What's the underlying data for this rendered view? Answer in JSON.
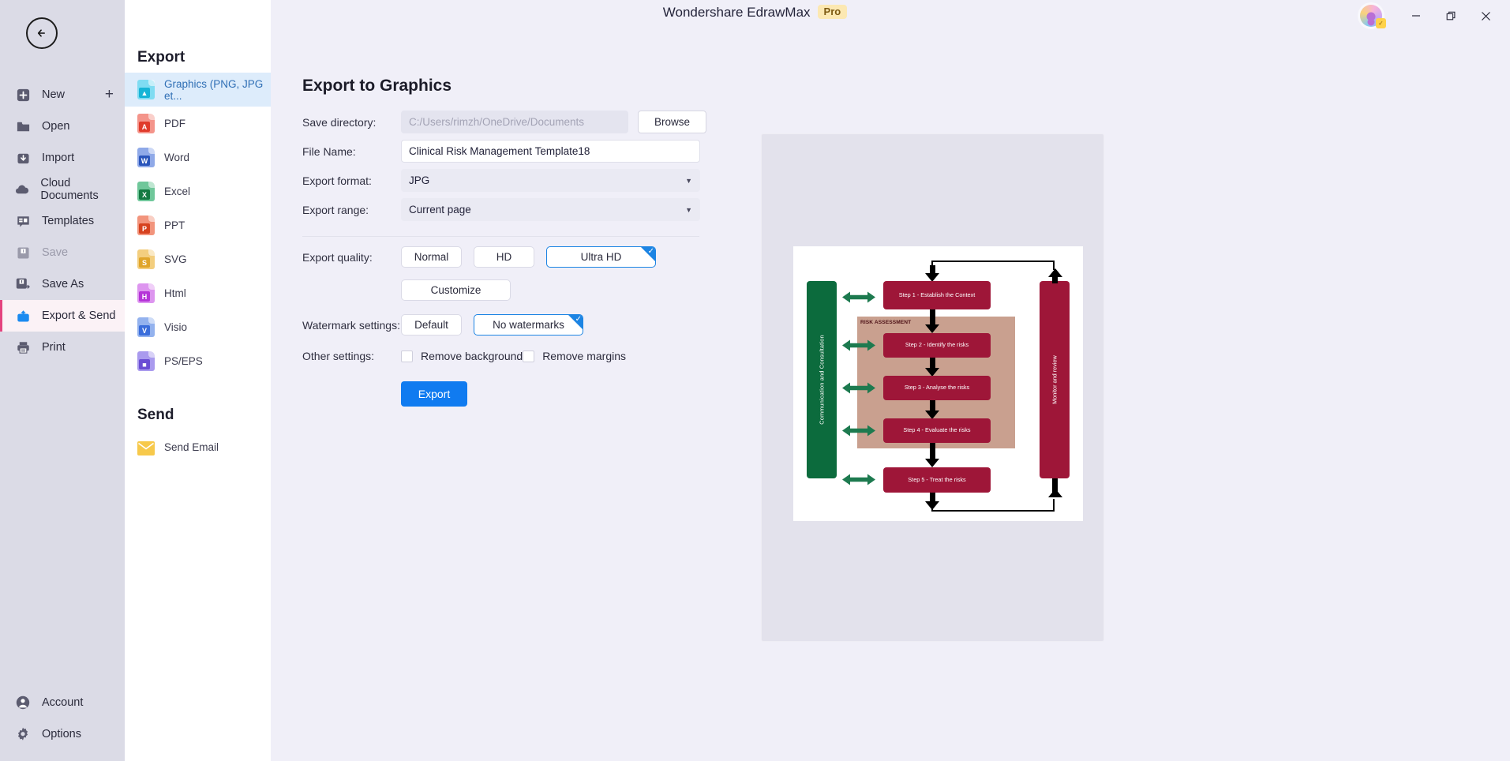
{
  "window": {
    "app_title": "Wondershare EdrawMax",
    "pro_badge": "Pro",
    "minimize": "—",
    "restore": "❐",
    "close": "✕"
  },
  "toolbar_icons": [
    {
      "name": "help-icon",
      "glyph": "?",
      "badge": true,
      "caret": true
    },
    {
      "name": "notifications-icon",
      "glyph": "🔔",
      "badge": true,
      "caret": false
    },
    {
      "name": "apps-grid-icon",
      "glyph": "☷",
      "badge": false,
      "caret": true
    },
    {
      "name": "theme-shirt-icon",
      "glyph": "👕",
      "badge": false,
      "caret": true
    },
    {
      "name": "settings-gear-icon",
      "glyph": "⚙",
      "badge": false,
      "caret": false
    }
  ],
  "leftnav": {
    "back_label": "←",
    "items": [
      {
        "label": "New",
        "icon": "new-document-icon",
        "plus": true,
        "state": "normal"
      },
      {
        "label": "Open",
        "icon": "folder-open-icon",
        "plus": false,
        "state": "normal"
      },
      {
        "label": "Import",
        "icon": "import-icon",
        "plus": false,
        "state": "normal"
      },
      {
        "label": "Cloud Documents",
        "icon": "cloud-icon",
        "plus": false,
        "state": "normal"
      },
      {
        "label": "Templates",
        "icon": "templates-icon",
        "plus": false,
        "state": "normal"
      },
      {
        "label": "Save",
        "icon": "save-disk-icon",
        "plus": false,
        "state": "disabled"
      },
      {
        "label": "Save As",
        "icon": "save-as-icon",
        "plus": false,
        "state": "normal"
      },
      {
        "label": "Export & Send",
        "icon": "export-share-icon",
        "plus": false,
        "state": "active"
      },
      {
        "label": "Print",
        "icon": "printer-icon",
        "plus": false,
        "state": "normal"
      }
    ],
    "bottom_items": [
      {
        "label": "Account",
        "icon": "account-person-icon"
      },
      {
        "label": "Options",
        "icon": "options-gear-icon"
      }
    ]
  },
  "export_list": {
    "title": "Export",
    "items": [
      {
        "label": "Graphics (PNG, JPG et...",
        "icon": "image-file-icon",
        "color": "#4ec7e8",
        "glyph": "⛰",
        "active": true
      },
      {
        "label": "PDF",
        "icon": "pdf-file-icon",
        "color": "#e8574a",
        "glyph": "A",
        "active": false
      },
      {
        "label": "Word",
        "icon": "word-file-icon",
        "color": "#3d6fd0",
        "glyph": "W",
        "active": false
      },
      {
        "label": "Excel",
        "icon": "excel-file-icon",
        "color": "#1e9150",
        "glyph": "X",
        "active": false
      },
      {
        "label": "PPT",
        "icon": "ppt-file-icon",
        "color": "#e2502a",
        "glyph": "P",
        "active": false
      },
      {
        "label": "SVG",
        "icon": "svg-file-icon",
        "color": "#e8b13a",
        "glyph": "S",
        "active": false
      },
      {
        "label": "Html",
        "icon": "html-file-icon",
        "color": "#c450e0",
        "glyph": "H",
        "active": false
      },
      {
        "label": "Visio",
        "icon": "visio-file-icon",
        "color": "#4e7fe0",
        "glyph": "V",
        "active": false
      },
      {
        "label": "PS/EPS",
        "icon": "ps-eps-file-icon",
        "color": "#8060dd",
        "glyph": "■",
        "active": false
      }
    ],
    "send_title": "Send",
    "send_items": [
      {
        "label": "Send Email",
        "icon": "email-envelope-icon",
        "color": "#f5c244",
        "glyph": "✉"
      }
    ]
  },
  "pane": {
    "title": "Export to Graphics",
    "fields": {
      "save_directory_label": "Save directory:",
      "save_directory_value": "C:/Users/rimzh/OneDrive/Documents",
      "browse_label": "Browse",
      "file_name_label": "File Name:",
      "file_name_value": "Clinical Risk Management Template18",
      "export_format_label": "Export format:",
      "export_format_value": "JPG",
      "export_range_label": "Export range:",
      "export_range_value": "Current page"
    },
    "quality": {
      "label": "Export quality:",
      "options": [
        "Normal",
        "HD",
        "Ultra HD"
      ],
      "selected": "Ultra HD",
      "customize_label": "Customize"
    },
    "watermark": {
      "label": "Watermark settings:",
      "options": [
        "Default",
        "No watermarks"
      ],
      "selected": "No watermarks"
    },
    "other": {
      "label": "Other settings:",
      "checkboxes": [
        {
          "label": "Remove background",
          "checked": false
        },
        {
          "label": "Remove margins",
          "checked": false
        }
      ]
    },
    "export_button": "Export",
    "accent_color": "#107bf0",
    "select_color": "#1c84e3"
  },
  "preview": {
    "diagram": {
      "left_band": "Communication and Consultation",
      "right_band": "Monitor and review",
      "assessment_label": "RISK ASSESSMENT",
      "steps": [
        "Step 1 - Establish the Context",
        "Step 2 - Identify  the risks",
        "Step 3 - Analyse the risks",
        "Step 4 - Evaluate the risks",
        "Step 5 - Treat the risks"
      ],
      "colors": {
        "band_green": "#0c6b3d",
        "step_maroon": "#9e1638",
        "assessment_tan": "#c9a08f",
        "arrow_green": "#1d7a4f"
      }
    }
  }
}
